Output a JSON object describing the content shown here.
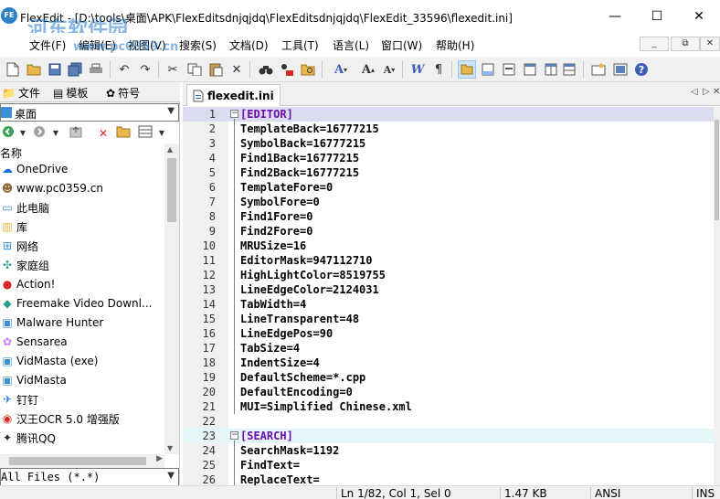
{
  "window": {
    "app_icon": "FE",
    "title": "FlexEdit - [D:\\tools\\桌面\\APK\\FlexEditsdnjqjdq\\FlexEditsdnjqjdq\\FlexEdit_33596\\flexedit.ini]",
    "minimize": "—",
    "maximize": "☐",
    "close": "✕",
    "watermark": "河东软件园",
    "watermark_url": "www.pc0359.cn"
  },
  "menubar": {
    "items": [
      "文件(F)",
      "编辑(E)",
      "视图(V)",
      "搜索(S)",
      "文档(D)",
      "工具(T)",
      "语言(L)",
      "窗口(W)",
      "帮助(H)"
    ],
    "mdi_minimize": "_",
    "mdi_restore": "⧉",
    "mdi_close": "✕"
  },
  "toolbar": {
    "icons": [
      "new-file-icon",
      "open-folder-icon",
      "save-icon",
      "save-all-icon",
      "print-icon",
      "undo-icon",
      "redo-icon",
      "cut-icon",
      "copy-icon",
      "paste-icon",
      "delete-icon",
      "find-icon",
      "replace-icon",
      "find-in-files-icon",
      "font-icon",
      "increase-font-icon",
      "decrease-font-icon",
      "word-wrap-icon",
      "show-whitespace-icon",
      "file-panel-icon",
      "output-panel-icon",
      "console-icon",
      "split-horizontal-icon",
      "split-vertical-icon",
      "options-icon",
      "fullscreen-icon",
      "help-icon"
    ]
  },
  "left_panel": {
    "tabs": [
      {
        "label": "文件",
        "icon": "folder-icon"
      },
      {
        "label": "模板",
        "icon": "template-icon"
      },
      {
        "label": "符号",
        "icon": "symbol-icon"
      }
    ],
    "current_folder": "桌面",
    "column_header": "名称",
    "items": [
      {
        "label": "OneDrive",
        "icon": "cloud-icon",
        "color": "#1e6fd9"
      },
      {
        "label": "www.pc0359.cn",
        "icon": "user-icon",
        "color": "#8a6a3a"
      },
      {
        "label": "此电脑",
        "icon": "computer-icon",
        "color": "#3b8fd6"
      },
      {
        "label": "库",
        "icon": "library-icon",
        "color": "#e8b84a"
      },
      {
        "label": "网络",
        "icon": "network-icon",
        "color": "#3b8fd6"
      },
      {
        "label": "家庭组",
        "icon": "homegroup-icon",
        "color": "#2a9d8f"
      },
      {
        "label": "Action!",
        "icon": "action-icon",
        "color": "#d62828"
      },
      {
        "label": "Freemake Video Downl...",
        "icon": "freemake-icon",
        "color": "#2a9d8f"
      },
      {
        "label": "Malware Hunter",
        "icon": "malware-hunter-icon",
        "color": "#3b8fd6"
      },
      {
        "label": "Sensarea",
        "icon": "sensarea-icon",
        "color": "#c77dff"
      },
      {
        "label": "VidMasta (exe)",
        "icon": "vidmasta-icon",
        "color": "#3b8fd6"
      },
      {
        "label": "VidMasta",
        "icon": "vidmasta-icon",
        "color": "#3b8fd6"
      },
      {
        "label": "钉钉",
        "icon": "dingtalk-icon",
        "color": "#1e88e5"
      },
      {
        "label": "汉王OCR 5.0 增强版",
        "icon": "ocr-icon",
        "color": "#d62828"
      },
      {
        "label": "腾讯QQ",
        "icon": "qq-icon",
        "color": "#222222"
      }
    ],
    "filter": "All Files (*.*)"
  },
  "document": {
    "tab_label": "flexedit.ini",
    "lines": [
      {
        "n": "1",
        "type": "section",
        "text": "[EDITOR]"
      },
      {
        "n": "2",
        "type": "kv",
        "key": "TemplateBack",
        "value": "16777215"
      },
      {
        "n": "3",
        "type": "kv",
        "key": "SymbolBack",
        "value": "16777215"
      },
      {
        "n": "4",
        "type": "kv",
        "key": "Find1Back",
        "value": "16777215"
      },
      {
        "n": "5",
        "type": "kv",
        "key": "Find2Back",
        "value": "16777215"
      },
      {
        "n": "6",
        "type": "kv",
        "key": "TemplateFore",
        "value": "0"
      },
      {
        "n": "7",
        "type": "kv",
        "key": "SymbolFore",
        "value": "0"
      },
      {
        "n": "8",
        "type": "kv",
        "key": "Find1Fore",
        "value": "0"
      },
      {
        "n": "9",
        "type": "kv",
        "key": "Find2Fore",
        "value": "0"
      },
      {
        "n": "10",
        "type": "kv",
        "key": "MRUSize",
        "value": "16"
      },
      {
        "n": "11",
        "type": "kv",
        "key": "EditorMask",
        "value": "947112710"
      },
      {
        "n": "12",
        "type": "kv",
        "key": "HighLightColor",
        "value": "8519755"
      },
      {
        "n": "13",
        "type": "kv",
        "key": "LineEdgeColor",
        "value": "2124031"
      },
      {
        "n": "14",
        "type": "kv",
        "key": "TabWidth",
        "value": "4"
      },
      {
        "n": "15",
        "type": "kv",
        "key": "LineTransparent",
        "value": "48"
      },
      {
        "n": "16",
        "type": "kv",
        "key": "LineEdgePos",
        "value": "90"
      },
      {
        "n": "17",
        "type": "kv",
        "key": "TabSize",
        "value": "4"
      },
      {
        "n": "18",
        "type": "kv",
        "key": "IndentSize",
        "value": "4"
      },
      {
        "n": "19",
        "type": "kv",
        "key": "DefaultScheme",
        "value": "*.cpp"
      },
      {
        "n": "20",
        "type": "kv",
        "key": "DefaultEncoding",
        "value": "0"
      },
      {
        "n": "21",
        "type": "kv",
        "key": "MUI",
        "value": "Simplified Chinese.xml"
      },
      {
        "n": "22",
        "type": "blank",
        "text": ""
      },
      {
        "n": "23",
        "type": "section",
        "text": "[SEARCH]"
      },
      {
        "n": "24",
        "type": "kv",
        "key": "SearchMask",
        "value": "1192"
      },
      {
        "n": "25",
        "type": "kv",
        "key": "FindText",
        "value": ""
      },
      {
        "n": "26",
        "type": "kv",
        "key": "ReplaceText",
        "value": ""
      }
    ]
  },
  "statusbar": {
    "position": "Ln 1/82, Col 1, Sel 0",
    "size": "1.47 KB",
    "encoding": "ANSI",
    "mode": "INS"
  },
  "colors": {
    "section_text": "#6b0dad",
    "current_line": "#dcdcf0",
    "toolbar_bg": "#f0f0f0",
    "active_toolbar_button": "#cce4f7"
  }
}
